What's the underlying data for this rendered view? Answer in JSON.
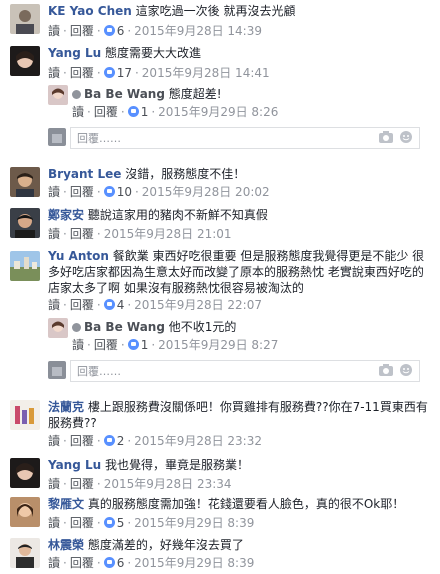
{
  "actions": {
    "reply": "讀",
    "respond": "回覆"
  },
  "reply_placeholder": "回覆……",
  "comments": [
    {
      "name": "KE Yao Chen",
      "text": "這家吃過一次後 就再沒去光顧",
      "likes": "6",
      "time": "2015年9月28日 14:39"
    },
    {
      "name": "Yang Lu",
      "text": "態度需要大大改進",
      "likes": "17",
      "time": "2015年9月28日 14:41",
      "reply": {
        "name": "Ba Be Wang",
        "text": "態度超差!",
        "likes": "1",
        "time": "2015年9月29日 8:26"
      }
    },
    {
      "name": "Bryant Lee",
      "text": "沒錯，服務態度不佳！",
      "likes": "10",
      "time": "2015年9月28日 20:02"
    },
    {
      "name": "鄭家安",
      "text": "聽說這家用的豬肉不新鮮不知真假",
      "likes": "",
      "time": "2015年9月28日 21:01"
    },
    {
      "name": "Yu Anton",
      "text": "餐飲業 東西好吃很重要 但是服務態度我覺得更是不能少 很多好吃店家都因為生意太好而改變了原本的服務熱忱 老實說東西好吃的店家太多了啊 如果沒有服務熱忱很容易被淘汰的",
      "likes": "4",
      "time": "2015年9月28日 22:07",
      "reply": {
        "name": "Ba Be Wang",
        "text": "他不收1元的",
        "likes": "1",
        "time": "2015年9月29日 8:27"
      }
    },
    {
      "name": "法蘭克",
      "text": "樓上跟服務費沒關係吧！你買雞排有服務費??你在7-11買東西有服務費??",
      "likes": "2",
      "time": "2015年9月28日 23:32"
    },
    {
      "name": "Yang Lu",
      "text": "我也覺得，畢竟是服務業！",
      "likes": "",
      "time": "2015年9月28日 23:34"
    },
    {
      "name": "黎雁文",
      "text": "真的服務態度需加強！花錢還要看人臉色，真的很不Ok耶！",
      "likes": "5",
      "time": "2015年9月29日 8:39"
    },
    {
      "name": "林震榮",
      "text": "態度滿差的，好幾年沒去買了",
      "likes": "6",
      "time": "2015年9月29日 8:39"
    }
  ]
}
